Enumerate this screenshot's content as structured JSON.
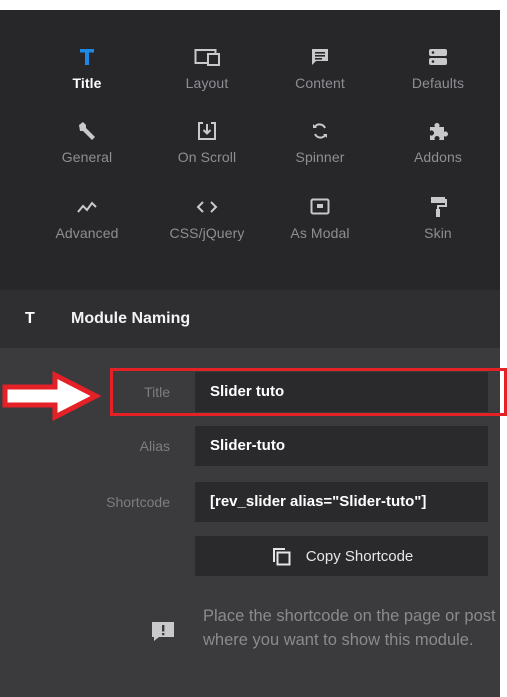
{
  "tabs": [
    {
      "label": "Title",
      "icon": "title-t-icon",
      "active": true
    },
    {
      "label": "Layout",
      "icon": "layout-icon"
    },
    {
      "label": "Content",
      "icon": "content-icon"
    },
    {
      "label": "Defaults",
      "icon": "defaults-icon"
    },
    {
      "label": "General",
      "icon": "wrench-icon"
    },
    {
      "label": "On Scroll",
      "icon": "on-scroll-icon"
    },
    {
      "label": "Spinner",
      "icon": "spinner-icon"
    },
    {
      "label": "Addons",
      "icon": "puzzle-icon"
    },
    {
      "label": "Advanced",
      "icon": "advanced-icon"
    },
    {
      "label": "CSS/jQuery",
      "icon": "code-icon"
    },
    {
      "label": "As Modal",
      "icon": "modal-icon"
    },
    {
      "label": "Skin",
      "icon": "paint-roller-icon"
    }
  ],
  "section": {
    "icon_text": "T",
    "title": "Module Naming"
  },
  "fields": {
    "title": {
      "label": "Title",
      "value": "Slider tuto"
    },
    "alias": {
      "label": "Alias",
      "value": "Slider-tuto"
    },
    "shortcode": {
      "label": "Shortcode",
      "value": "[rev_slider alias=\"Slider-tuto\"]"
    }
  },
  "copy_button": {
    "label": "Copy Shortcode"
  },
  "info": {
    "text": "Place the shortcode on the page or post where you want to show this module."
  },
  "colors": {
    "accent": "#1e88e5",
    "highlight": "#e32127",
    "panel": "#3b3b3e",
    "tabs_bg": "#27272a"
  }
}
